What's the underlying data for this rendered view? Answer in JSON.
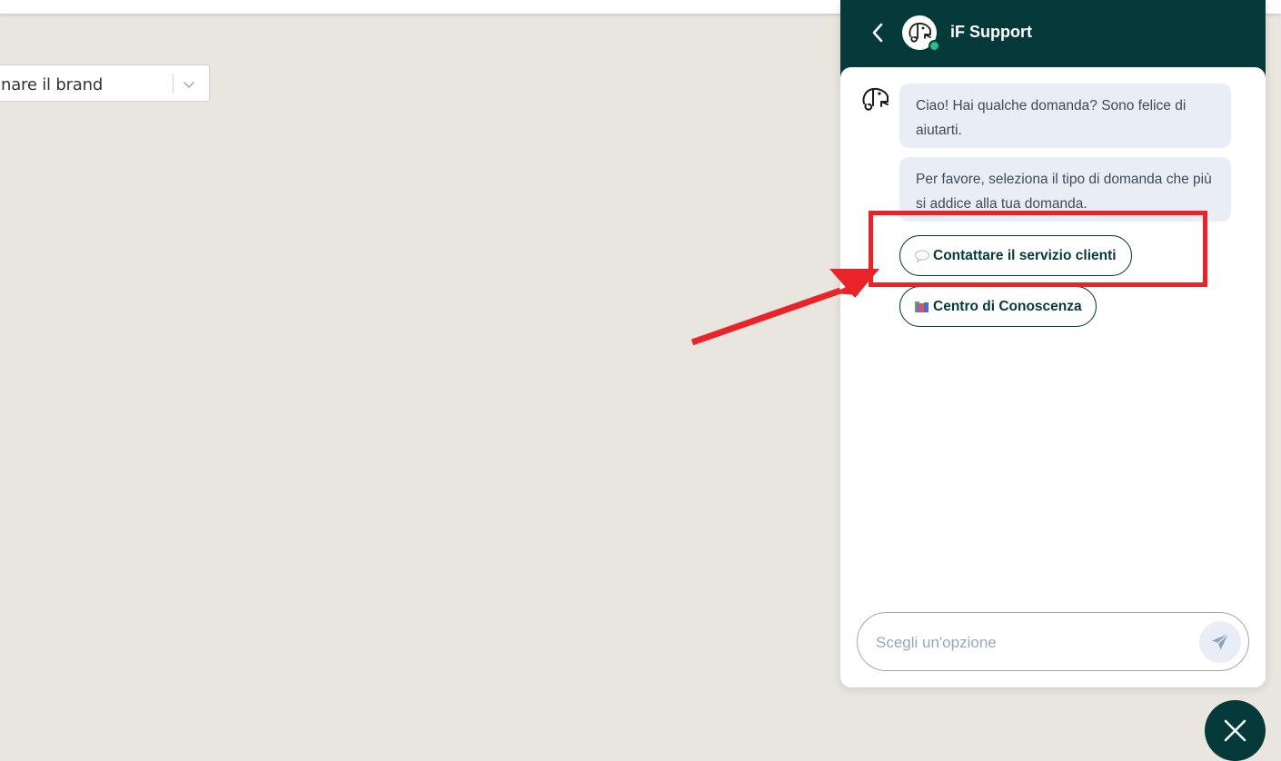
{
  "page": {
    "brand_select_text": "nare il brand"
  },
  "chat": {
    "title": "iF Support",
    "status": "online",
    "messages": [
      "Ciao! Hai qualche domanda? Sono felice di aiutarti.",
      "Per favore, seleziona il tipo di domanda che più si addice alla tua domanda."
    ],
    "options": [
      {
        "label": "Contattare il servizio clienti",
        "icon": "speech-bubble-icon"
      },
      {
        "label": "Centro di Conoscenza",
        "icon": "books-icon"
      }
    ],
    "input_placeholder": "Scegli un'opzione"
  },
  "annotation": {
    "color": "#e8242a",
    "target": "Contattare il servizio clienti"
  },
  "colors": {
    "header": "#063a3a",
    "bubble": "#e9eef6",
    "online": "#22c08b",
    "background": "#e9e6df"
  }
}
